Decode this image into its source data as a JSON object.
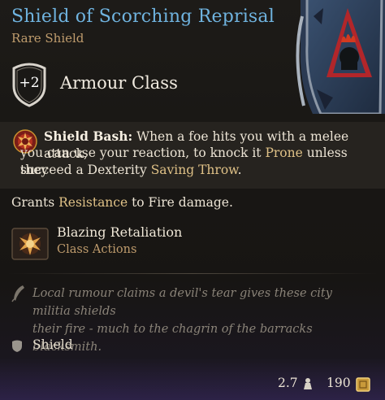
{
  "item": {
    "name": "Shield of Scorching Reprisal",
    "rarity": "Rare Shield"
  },
  "armour": {
    "value": "+2",
    "label": "Armour Class"
  },
  "shield_bash": {
    "name": "Shield Bash:",
    "line1": "When a foe hits you with a melee attack,",
    "line2_a": "you can use your reaction, to knock it ",
    "line2_keyword": "Prone",
    "line2_b": " unless they",
    "line3_a": "succeed a Dexterity ",
    "line3_keyword": "Saving Throw",
    "line3_b": "."
  },
  "grants": {
    "prefix": "Grants ",
    "keyword": "Resistance",
    "suffix": " to Fire damage."
  },
  "action": {
    "name": "Blazing Retaliation",
    "category": "Class Actions"
  },
  "lore": {
    "line1": "Local rumour claims a devil's tear gives these city militia shields",
    "line2": "their fire - much to the chagrin of the barracks blacksmith."
  },
  "footer": {
    "type": "Shield",
    "weight": "2.7",
    "price": "190"
  },
  "colors": {
    "title": "#6fb3df",
    "rarity": "#bf9c6d",
    "keyword": "#dfc187"
  },
  "icons": {
    "armour": "shield-badge-icon",
    "bash": "shield-bash-icon",
    "action": "blazing-retaliation-icon",
    "lore": "quill-icon",
    "type": "shield-icon",
    "weight": "weight-icon",
    "price": "gold-coin-icon"
  }
}
